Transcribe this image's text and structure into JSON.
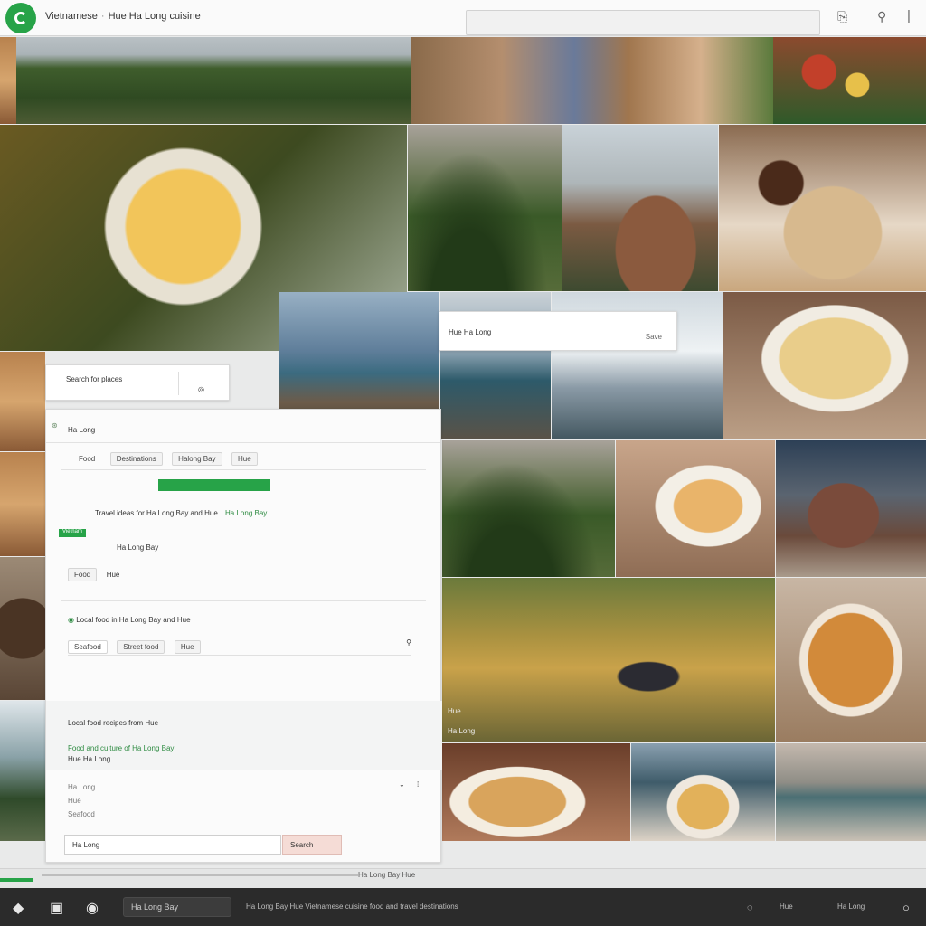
{
  "header": {
    "title": "Vietnamese",
    "subtitle": "Hue Ha Long cuisine",
    "search_placeholder": ""
  },
  "popup": {
    "title": "Hue Ha Long",
    "action": "Save"
  },
  "overlay_search": {
    "placeholder": "Search for places",
    "icon_label": ""
  },
  "panel": {
    "heading": "Ha Long",
    "tabs": [
      "Food",
      "Destinations",
      "Halong Bay",
      "Hue"
    ],
    "primary_button": "",
    "info_line_1": "Travel ideas for Ha Long Bay and Hue",
    "link_text": "Ha Long Bay",
    "badge": "Vietnam",
    "section_label": "Ha Long Bay",
    "filter_chip": "Food",
    "filter_value": "Hue",
    "check_label": "Local food in Ha Long Bay and Hue",
    "sub_chips": [
      "Seafood",
      "Street food",
      "Hue"
    ],
    "note_1": "Local food recipes from Hue",
    "note_2": "Food and culture of Ha Long Bay",
    "note_3": "Hue Ha Long",
    "list_items": [
      "Ha Long",
      "Hue",
      "Seafood"
    ],
    "input_value": "Ha Long",
    "input_button": "Search"
  },
  "photo_labels": {
    "field_caption": "Hue",
    "field_sub": "Ha Long"
  },
  "scroll": {
    "text": "Ha Long Bay Hue"
  },
  "taskbar": {
    "pill_label": "Ha Long Bay",
    "status_text": "Ha Long Bay Hue Vietnamese cuisine food and travel destinations",
    "right_label_1": "Hue",
    "right_label_2": "Ha Long"
  },
  "colors": {
    "brand_green": "#27a348",
    "taskbar": "#2b2b2b"
  },
  "icons": [
    "logo-icon",
    "share-icon",
    "search-icon",
    "menu-icon",
    "close-icon",
    "back-icon",
    "lock-icon",
    "camera-icon",
    "wifi-icon",
    "power-icon"
  ]
}
